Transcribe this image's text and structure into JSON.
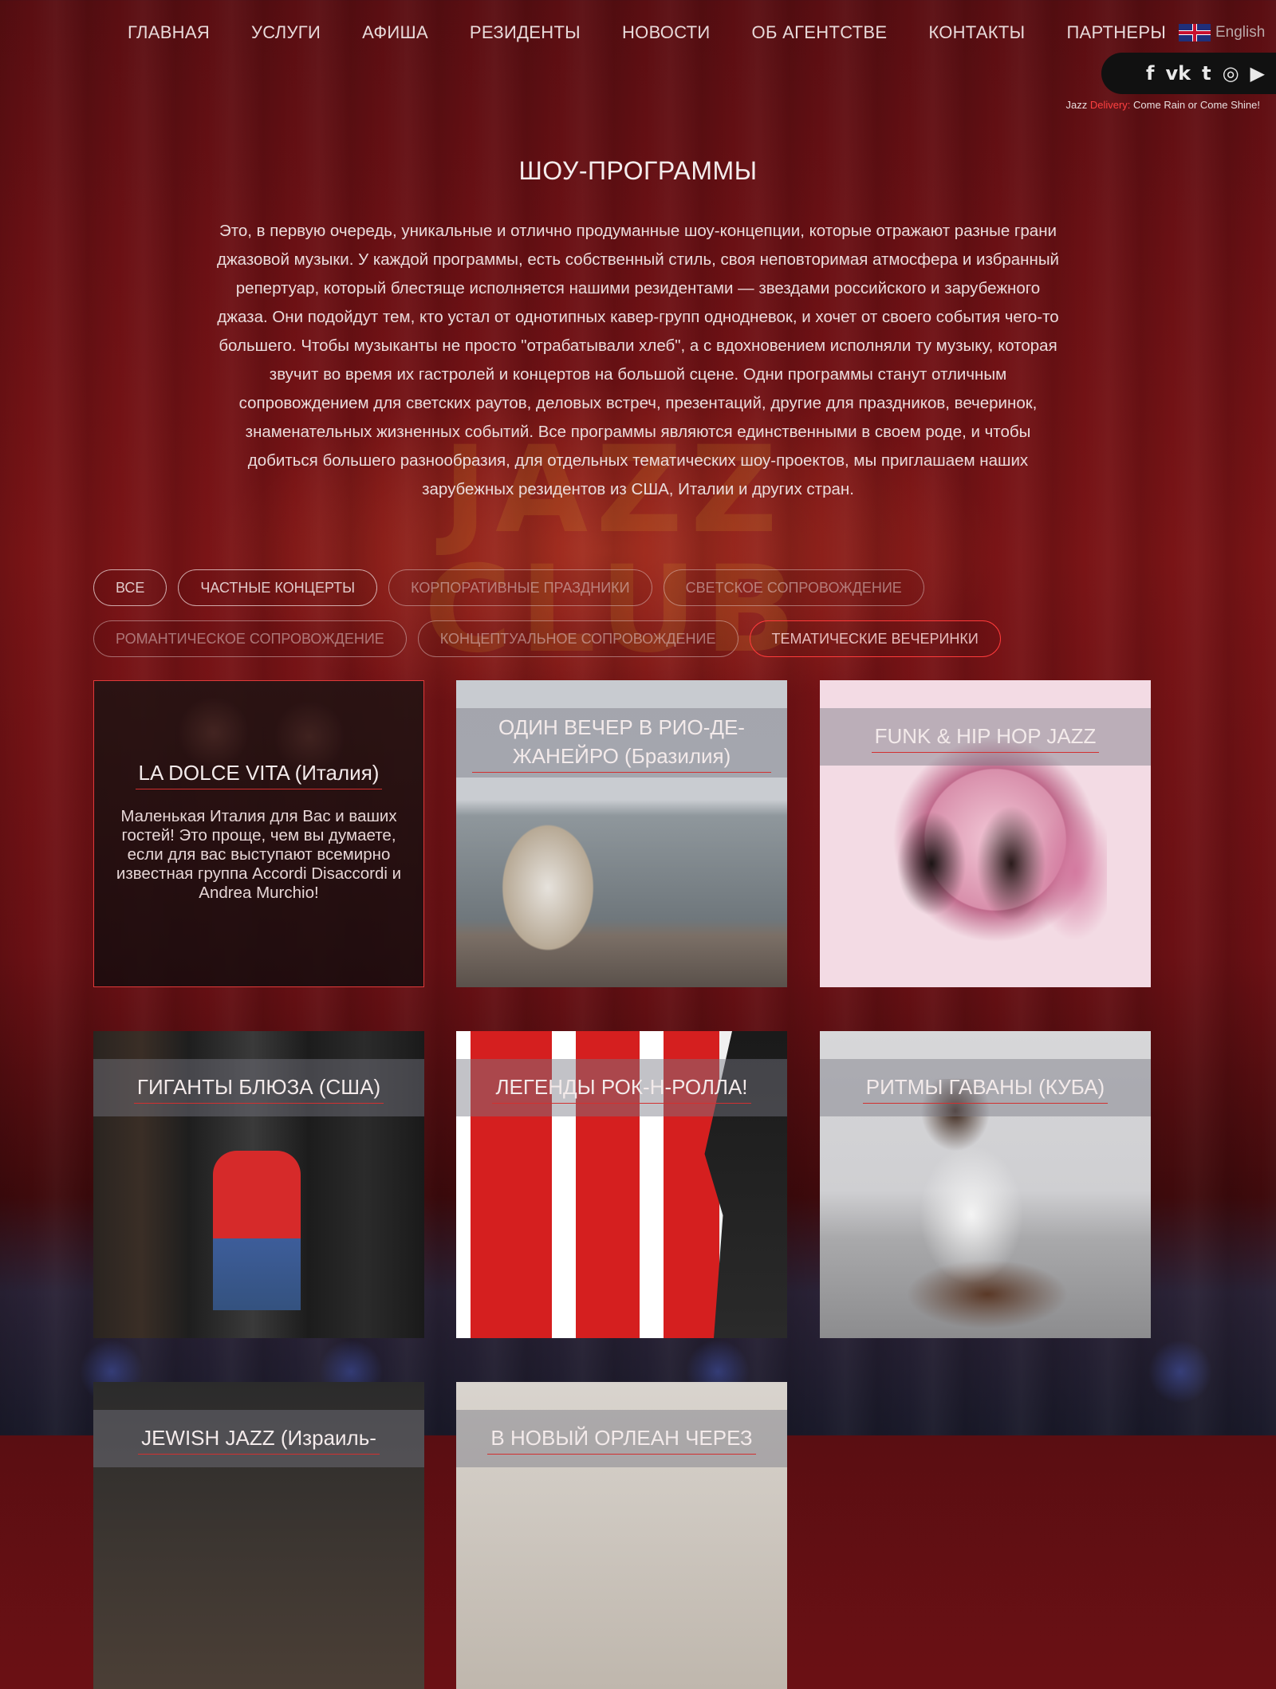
{
  "nav": {
    "items": [
      "ГЛАВНАЯ",
      "УСЛУГИ",
      "АФИША",
      "РЕЗИДЕНТЫ",
      "НОВОСТИ",
      "ОБ АГЕНТСТВЕ",
      "КОНТАКТЫ",
      "ПАРТНЕРЫ"
    ],
    "language": "English"
  },
  "social": {
    "icons": [
      "facebook-icon",
      "vk-icon",
      "twitter-icon",
      "instagram-icon",
      "youtube-icon"
    ],
    "glyphs": [
      "f",
      "vk",
      "t",
      "◎",
      "▶"
    ]
  },
  "tagline": {
    "part1": "Jazz ",
    "part2": "Delivery:",
    "part3": " Come Rain or Come Shine!"
  },
  "page": {
    "title": "ШОУ-ПРОГРАММЫ",
    "intro": "Это, в первую очередь, уникальные и отлично продуманные шоу-концепции, которые отражают разные грани джазовой музыки. У каждой программы, есть собственный стиль, своя неповторимая атмосфера и избранный репертуар, который блестяще исполняется нашими резидентами — звездами российского и зарубежного джаза. Они подойдут тем, кто устал от однотипных кавер-групп однодневок, и хочет от своего события чего-то большего. Чтобы музыканты не просто \"отрабатывали хлеб\", а с вдохновением исполняли ту музыку, которая звучит во время их гастролей и концертов на большой сцене. Одни программы станут отличным сопровождением для светских раутов, деловых встреч, презентаций, другие для праздников, вечеринок, знаменательных жизненных событий. Все программы являются единственными в своем роде, и чтобы добиться большего разнообразия, для отдельных тематических шоу-проектов, мы приглашаем наших зарубежных резидентов из США, Италии и других стран."
  },
  "filters": {
    "items": [
      "ВСЕ",
      "ЧАСТНЫЕ КОНЦЕРТЫ",
      "КОРПОРАТИВНЫЕ ПРАЗДНИКИ",
      "СВЕТСКОЕ СОПРОВОЖДЕНИЕ",
      "РОМАНТИЧЕСКОЕ СОПРОВОЖДЕНИЕ",
      "КОНЦЕПТУАЛЬНОЕ СОПРОВОЖДЕНИЕ",
      "ТЕМАТИЧЕСКИЕ ВЕЧЕРИНКИ"
    ],
    "active": "ТЕМАТИЧЕСКИЕ ВЕЧЕРИНКИ"
  },
  "cards": [
    {
      "title": "LA DOLCE VITA (Италия)",
      "description": "Маленькая Италия для Вас и ваших гостей! Это проще, чем вы думаете, если для вас выступают всемирно известная группа Accordi Disaccordi и Andrea Murchio!"
    },
    {
      "title": "ОДИН ВЕЧЕР В РИО-ДЕ-ЖАНЕЙРО (Бразилия)"
    },
    {
      "title": "FUNK & HIP HOP JAZZ"
    },
    {
      "title": "ГИГАНТЫ БЛЮЗА (США)"
    },
    {
      "title": "ЛЕГЕНДЫ РОК-Н-РОЛЛА!"
    },
    {
      "title": "РИТМЫ ГАВАНЫ (КУБА)"
    },
    {
      "title": "JEWISH JAZZ (Израиль-"
    },
    {
      "title": "В НОВЫЙ ОРЛЕАН ЧЕРЕЗ"
    }
  ],
  "background_sign": "JAZZ CLUB",
  "colors": {
    "accent": "#e03a3a",
    "tagline_accent": "#ff4040",
    "background": "#6a1014"
  }
}
